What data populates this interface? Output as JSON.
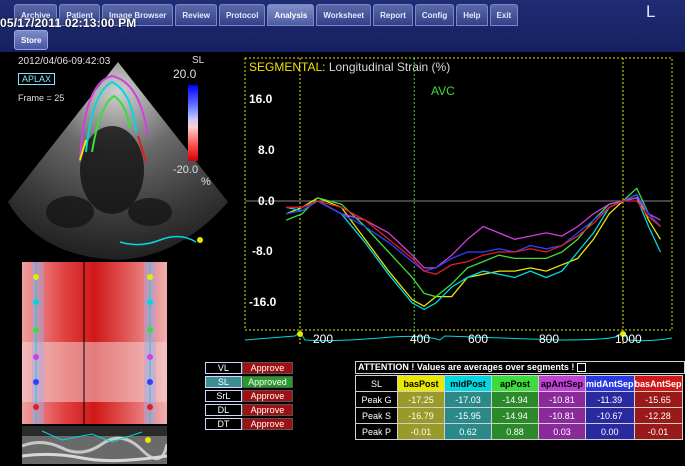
{
  "menu": {
    "tabs": [
      {
        "label": "Archive"
      },
      {
        "label": "Patient"
      },
      {
        "label": "Image Browser"
      },
      {
        "label": "Review"
      },
      {
        "label": "Protocol"
      },
      {
        "label": "Analysis"
      },
      {
        "label": "Worksheet"
      },
      {
        "label": "Report"
      },
      {
        "label": "Config"
      },
      {
        "label": "Help"
      },
      {
        "label": "Exit"
      }
    ],
    "active_tab": "Analysis",
    "sub_button": "Store",
    "brand_letter": "L"
  },
  "header": {
    "datetime": "05/17/2011 02:13:00 PM"
  },
  "echo": {
    "acq_datetime": "2012/04/06-09:42:03",
    "view": "APLAX",
    "frame": "Frame = 25",
    "scale_label": "SL",
    "scale_max": "20.0",
    "scale_min": "-20.0",
    "scale_unit": "%"
  },
  "chart_data": {
    "type": "line",
    "title_prefix": "SEGMENTAL:",
    "title": "Longitudinal Strain (%)",
    "marker_label": "AVC",
    "x_ticks": [
      200,
      400,
      600,
      800,
      1000
    ],
    "y_ticks": [
      "16.0",
      "8.0",
      "0.0",
      "-8.0",
      "-16.0"
    ],
    "xlim": [
      120,
      1070
    ],
    "ylim": [
      -20,
      20
    ],
    "markers_ms": [
      155,
      445,
      975
    ],
    "series": [
      {
        "color": "#e8e800",
        "x": [
          120,
          160,
          200,
          260,
          320,
          380,
          440,
          470,
          500,
          540,
          580,
          620,
          660,
          700,
          740,
          780,
          820,
          860,
          900,
          940,
          975,
          1010,
          1040,
          1070
        ],
        "y": [
          -2,
          -1,
          0.5,
          -1,
          -6,
          -11,
          -15.5,
          -16.5,
          -15,
          -15,
          -12,
          -11.5,
          -11,
          -11,
          -10.5,
          -11,
          -10,
          -9,
          -6,
          -2,
          0,
          1,
          -3,
          -6
        ]
      },
      {
        "color": "#00d8e0",
        "x": [
          120,
          160,
          200,
          260,
          320,
          380,
          440,
          470,
          500,
          540,
          580,
          620,
          660,
          700,
          740,
          780,
          820,
          860,
          900,
          940,
          975,
          1010,
          1040,
          1070
        ],
        "y": [
          -1,
          -1.5,
          0,
          -2,
          -6.5,
          -11.5,
          -16,
          -17,
          -16,
          -13.5,
          -12,
          -11,
          -11.5,
          -12,
          -11,
          -12,
          -11,
          -8,
          -5,
          -1,
          0,
          0.5,
          -4,
          -8
        ]
      },
      {
        "color": "#3cdc3c",
        "x": [
          120,
          160,
          200,
          260,
          320,
          380,
          440,
          470,
          500,
          540,
          580,
          620,
          660,
          700,
          740,
          780,
          820,
          860,
          900,
          940,
          975,
          1010,
          1040,
          1070
        ],
        "y": [
          -3,
          -2,
          0.5,
          -0.5,
          -4,
          -8,
          -12,
          -14.5,
          -15,
          -13,
          -10.5,
          -9.5,
          -8.5,
          -9,
          -9,
          -9,
          -8,
          -6,
          -3,
          -0.5,
          0,
          2,
          -2,
          -4
        ]
      },
      {
        "color": "#d040e0",
        "x": [
          120,
          160,
          200,
          260,
          320,
          380,
          440,
          470,
          500,
          540,
          580,
          620,
          660,
          700,
          740,
          780,
          820,
          860,
          900,
          940,
          975,
          1010,
          1040,
          1070
        ],
        "y": [
          -1,
          -1,
          0,
          -2,
          -3,
          -5,
          -8.5,
          -10.5,
          -10.5,
          -8.5,
          -6,
          -4,
          -5,
          -6,
          -5.5,
          -5,
          -5.5,
          -4,
          -2,
          -0.5,
          0,
          0.5,
          -2,
          -3
        ]
      },
      {
        "color": "#3040ff",
        "x": [
          120,
          160,
          200,
          260,
          320,
          380,
          440,
          470,
          500,
          540,
          580,
          620,
          660,
          700,
          740,
          780,
          820,
          860,
          900,
          940,
          975,
          1010,
          1040,
          1070
        ],
        "y": [
          -2,
          -1.5,
          0,
          -2,
          -4,
          -6.5,
          -9.5,
          -11,
          -10.5,
          -9,
          -8,
          -8,
          -7.5,
          -8,
          -7,
          -7.5,
          -7,
          -5,
          -3,
          -1,
          0,
          1,
          -2,
          -4
        ]
      },
      {
        "color": "#e02020",
        "x": [
          120,
          160,
          200,
          260,
          320,
          380,
          440,
          470,
          500,
          540,
          580,
          620,
          660,
          700,
          740,
          780,
          820,
          860,
          900,
          940,
          975,
          1010,
          1040,
          1070
        ],
        "y": [
          -1,
          -1,
          0,
          -1,
          -3,
          -6,
          -9,
          -11,
          -11.5,
          -10,
          -9.5,
          -8.5,
          -8,
          -8,
          -7.5,
          -8,
          -7,
          -5.5,
          -3.5,
          -1,
          0,
          0,
          -2.5,
          -4
        ]
      }
    ]
  },
  "param_panel": [
    {
      "name": "VL",
      "status": "Approve",
      "color": "#a01010"
    },
    {
      "name": "SL",
      "status": "Approved",
      "color": "#2a9a2a"
    },
    {
      "name": "SrL",
      "status": "Approve",
      "color": "#a01010"
    },
    {
      "name": "DL",
      "status": "Approve",
      "color": "#a01010"
    },
    {
      "name": "DT",
      "status": "Approve",
      "color": "#a01010"
    }
  ],
  "segments": {
    "attention": "ATTENTION !  Values are averages over segments !",
    "row_label": "SL",
    "headers": [
      {
        "label": "basPost",
        "color": "#e8e800"
      },
      {
        "label": "midPost",
        "color": "#00d8e0"
      },
      {
        "label": "apPost",
        "color": "#3cdc3c"
      },
      {
        "label": "apAntSep",
        "color": "#c040d8"
      },
      {
        "label": "midAntSep",
        "color": "#2a38e0"
      },
      {
        "label": "basAntSep",
        "color": "#d01818"
      }
    ],
    "rows": [
      {
        "label": "Peak G",
        "values": [
          "-17.25",
          "-17.03",
          "-14.94",
          "-10.81",
          "-11.39",
          "-15.65"
        ]
      },
      {
        "label": "Peak S",
        "values": [
          "-16.79",
          "-15.95",
          "-14.94",
          "-10.81",
          "-10.67",
          "-12.28"
        ]
      },
      {
        "label": "Peak P",
        "values": [
          "-0.01",
          "0.62",
          "0.88",
          "0.03",
          "0.00",
          "-0.01"
        ]
      }
    ],
    "row_colors": [
      "#9a9a2a",
      "#2a8a8a",
      "#2a8a2a",
      "#8a2a9a",
      "#2a2aa0",
      "#9a1a1a"
    ]
  }
}
